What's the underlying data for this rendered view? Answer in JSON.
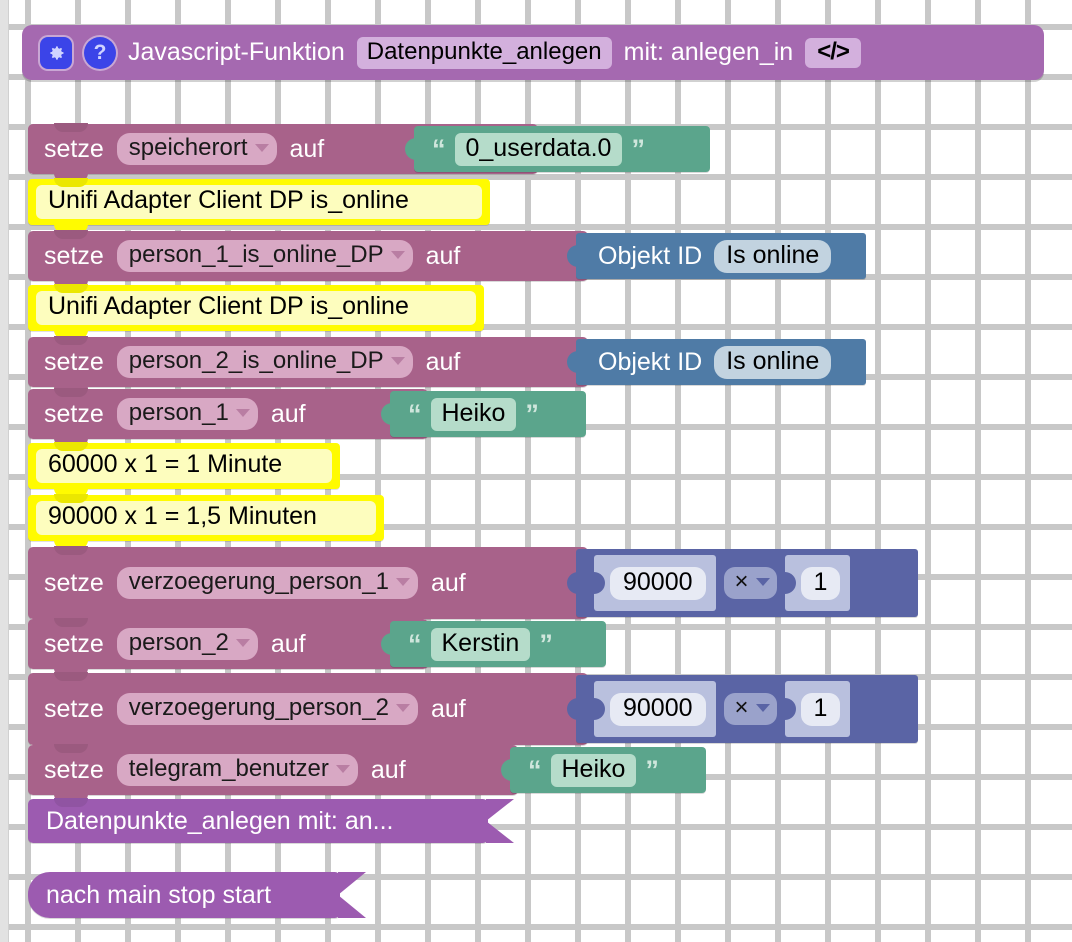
{
  "app": {
    "kind": "blockly-workspace",
    "language": "de",
    "background_color": "#ffffff",
    "grid_color": "#c8c8c8"
  },
  "header_block": {
    "name": "javascript-function-definition",
    "color": "#a569b0",
    "gear_icon": "gear-icon",
    "help_icon": "question-mark-icon",
    "prefix_label": "Javascript-Funktion",
    "function_name": "Datenpunkte_anlegen",
    "params_label": "mit: anlegen_in",
    "code_button_label": "</>"
  },
  "blocks": [
    {
      "id": "b1",
      "type": "variables_set",
      "color": "#a8628a",
      "keyword": "setze",
      "variable": "speicherort",
      "connector": "auf",
      "value": {
        "type": "text",
        "color": "#5ba58c",
        "open_quote": "“",
        "close_quote": "”",
        "text": "0_userdata.0"
      }
    },
    {
      "id": "c1",
      "type": "comment",
      "color": "#fffb00",
      "text": "Unifi Adapter Client DP is_online"
    },
    {
      "id": "b2",
      "type": "variables_set",
      "color": "#a8628a",
      "keyword": "setze",
      "variable": "person_1_is_online_DP",
      "connector": "auf",
      "value": {
        "type": "object_id",
        "color": "#4f7ba6",
        "label": "Objekt ID",
        "text": "Is online"
      }
    },
    {
      "id": "c2",
      "type": "comment",
      "color": "#fffb00",
      "text": "Unifi Adapter Client DP is_online"
    },
    {
      "id": "b3",
      "type": "variables_set",
      "color": "#a8628a",
      "keyword": "setze",
      "variable": "person_2_is_online_DP",
      "connector": "auf",
      "value": {
        "type": "object_id",
        "color": "#4f7ba6",
        "label": "Objekt ID",
        "text": "Is online"
      }
    },
    {
      "id": "b4",
      "type": "variables_set",
      "color": "#a8628a",
      "keyword": "setze",
      "variable": "person_1",
      "connector": "auf",
      "value": {
        "type": "text",
        "color": "#5ba58c",
        "open_quote": "“",
        "close_quote": "”",
        "text": "Heiko"
      }
    },
    {
      "id": "c3",
      "type": "comment",
      "color": "#fffb00",
      "text": "60000 x 1 = 1 Minute"
    },
    {
      "id": "c4",
      "type": "comment",
      "color": "#fffb00",
      "text": "90000 x 1 = 1,5 Minuten"
    },
    {
      "id": "b5",
      "type": "variables_set",
      "color": "#a8628a",
      "keyword": "setze",
      "variable": "verzoegerung_person_1",
      "connector": "auf",
      "value": {
        "type": "math_arithmetic",
        "color": "#5a64a5",
        "left": "90000",
        "operator": "×",
        "right": "1"
      }
    },
    {
      "id": "b6",
      "type": "variables_set",
      "color": "#a8628a",
      "keyword": "setze",
      "variable": "person_2",
      "connector": "auf",
      "value": {
        "type": "text",
        "color": "#5ba58c",
        "open_quote": "“",
        "close_quote": "”",
        "text": "Kerstin"
      }
    },
    {
      "id": "b7",
      "type": "variables_set",
      "color": "#a8628a",
      "keyword": "setze",
      "variable": "verzoegerung_person_2",
      "connector": "auf",
      "value": {
        "type": "math_arithmetic",
        "color": "#5a64a5",
        "left": "90000",
        "operator": "×",
        "right": "1"
      }
    },
    {
      "id": "b8",
      "type": "variables_set",
      "color": "#a8628a",
      "keyword": "setze",
      "variable": "telegram_benutzer",
      "connector": "auf",
      "value": {
        "type": "text",
        "color": "#5ba58c",
        "open_quote": "“",
        "close_quote": "”",
        "text": "Heiko"
      }
    },
    {
      "id": "b9",
      "type": "procedure_call",
      "color": "#9c5bb0",
      "text": "Datenpunkte_anlegen mit: an..."
    }
  ],
  "standalone_block": {
    "id": "b10",
    "type": "control_after",
    "color": "#9c5bb0",
    "text": "nach main  stop start"
  }
}
